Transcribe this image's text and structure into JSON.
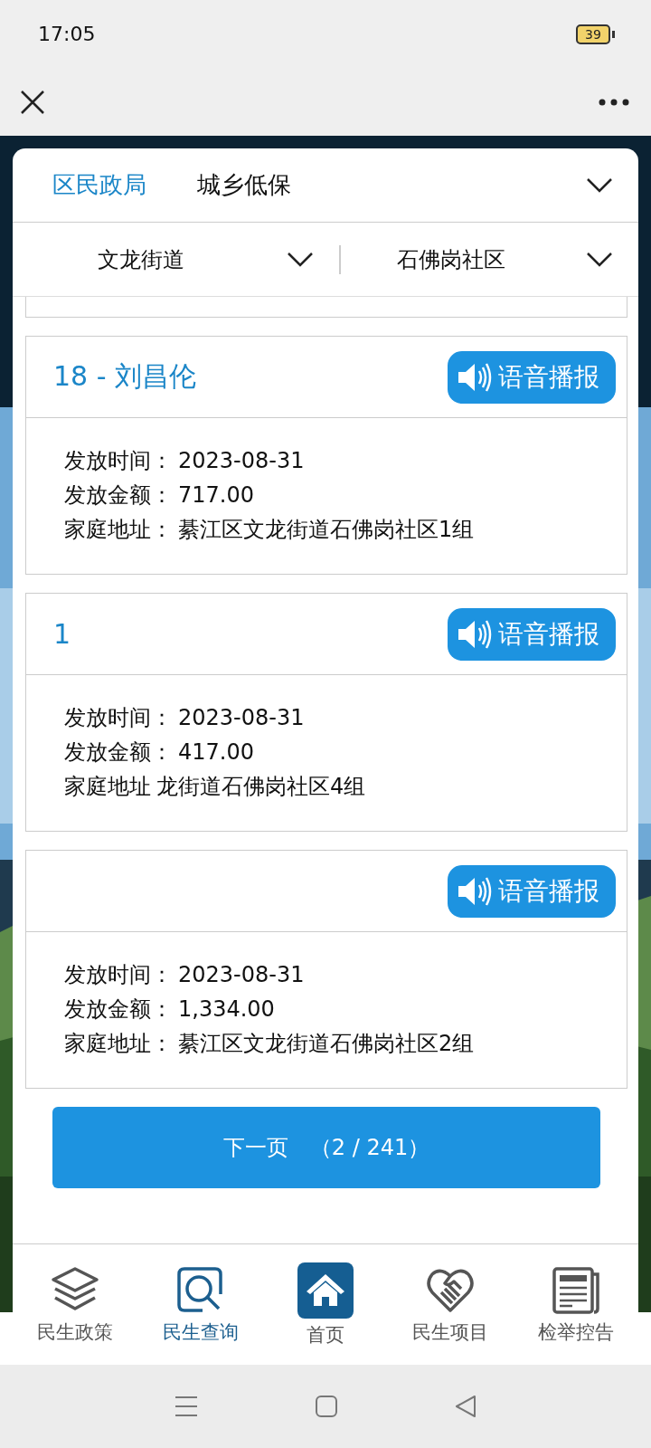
{
  "status_bar": {
    "time": "17:05",
    "battery": "39"
  },
  "filters": {
    "department": "区民政局",
    "category": "城乡低保",
    "street": "文龙街道",
    "community": "石佛岗社区"
  },
  "records": [
    {
      "title": "18 - 刘昌伦",
      "button": "语音播报",
      "date_label": "发放时间：",
      "date": "2023-08-31",
      "amount_label": "发放金额：",
      "amount": "717.00",
      "address_label": "家庭地址：",
      "address": "綦江区文龙街道石佛岗社区1组"
    },
    {
      "title": "1",
      "button": "语音播报",
      "date_label": "发放时间：",
      "date": "2023-08-31",
      "amount_label": "发放金额：",
      "amount": "417.00",
      "address_label": "家庭地址",
      "address": "龙街道石佛岗社区4组"
    },
    {
      "button": "语音播报",
      "date_label": "发放时间：",
      "date": "2023-08-31",
      "amount_label": "发放金额：",
      "amount": "1,334.00",
      "address_label": "家庭地址：",
      "address": "綦江区文龙街道石佛岗社区2组"
    }
  ],
  "next_button": "下一页　（2 / 241）",
  "nav": [
    {
      "label": "民生政策",
      "kind": "layers",
      "selected": false
    },
    {
      "label": "民生查询",
      "kind": "search",
      "selected": true
    },
    {
      "label": "首页",
      "kind": "home",
      "selected": false
    },
    {
      "label": "民生项目",
      "kind": "handshake",
      "selected": false
    },
    {
      "label": "检举控告",
      "kind": "news",
      "selected": false
    }
  ]
}
